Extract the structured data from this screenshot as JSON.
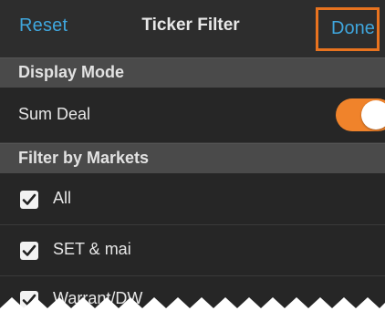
{
  "navbar": {
    "reset_label": "Reset",
    "title": "Ticker Filter",
    "done_label": "Done"
  },
  "sections": {
    "display_mode": {
      "header": "Display Mode",
      "sum_deal": {
        "label": "Sum Deal",
        "enabled": true
      }
    },
    "filter_by_markets": {
      "header": "Filter by Markets",
      "items": [
        {
          "label": "All",
          "checked": true
        },
        {
          "label": "SET & mai",
          "checked": true
        },
        {
          "label": "Warrant/DW",
          "checked": true
        }
      ]
    }
  },
  "colors": {
    "accent_link": "#3fa6dd",
    "toggle_on": "#f0832b",
    "highlight_border": "#e8731f"
  }
}
